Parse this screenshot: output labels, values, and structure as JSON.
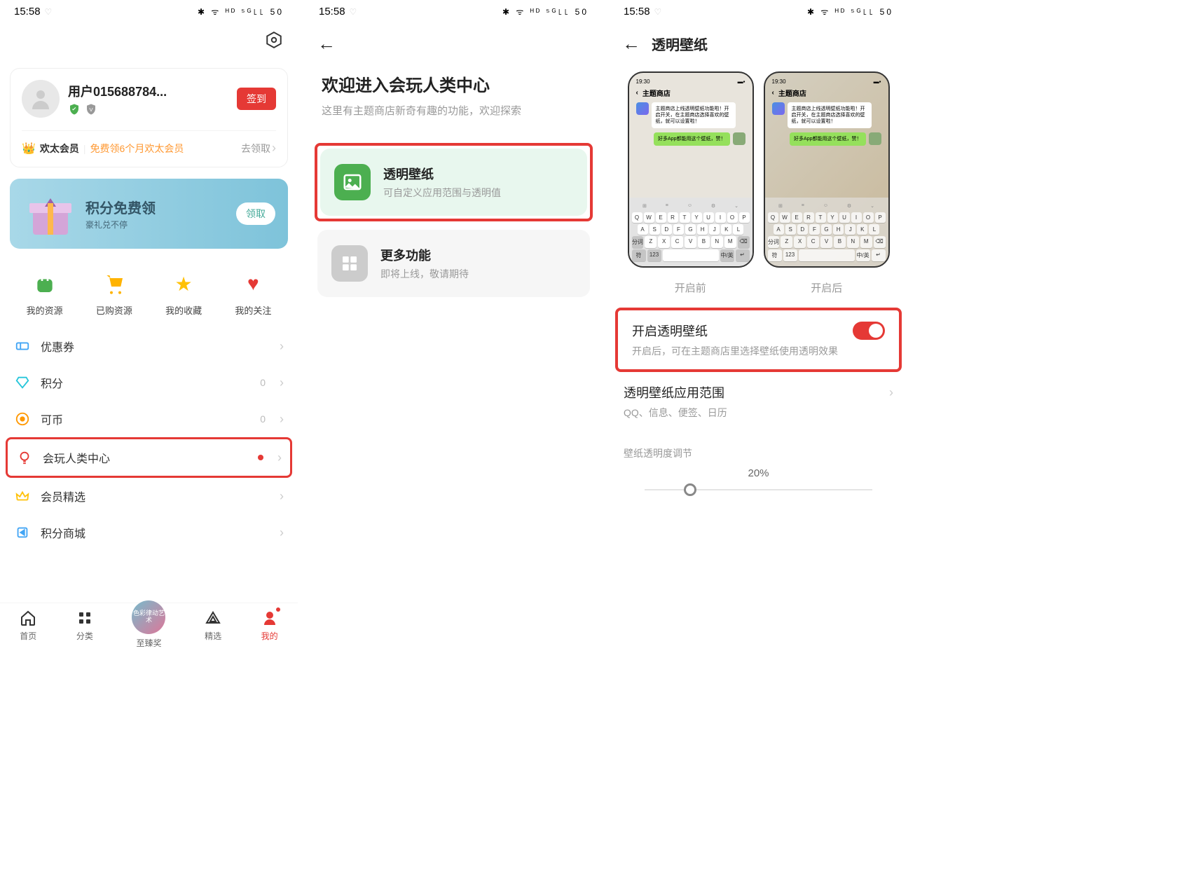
{
  "status": {
    "time": "15:58",
    "icons": "✱ ᯤ ᴴᴰ ⁵ᴳ꜖꜖ 50"
  },
  "phone1": {
    "username": "用户015688784...",
    "signin": "签到",
    "member_label": "欢太会员",
    "member_promo": "免费领6个月欢太会员",
    "member_action": "去领取",
    "points_title": "积分免费领",
    "points_sub": "豪礼兑不停",
    "claim": "领取",
    "quick": [
      "我的资源",
      "已购资源",
      "我的收藏",
      "我的关注"
    ],
    "menu": {
      "coupon": "优惠券",
      "points": "积分",
      "points_val": "0",
      "coin": "可币",
      "coin_val": "0",
      "play": "会玩人类中心",
      "premium": "会员精选",
      "mall": "积分商城"
    },
    "nav": [
      "首页",
      "分类",
      "至臻奖",
      "精选",
      "我的"
    ],
    "nav_center": "色彩律动艺术"
  },
  "phone2": {
    "title": "欢迎进入会玩人类中心",
    "subtitle": "这里有主题商店新奇有趣的功能，欢迎探索",
    "card1_title": "透明壁纸",
    "card1_sub": "可自定义应用范围与透明值",
    "card2_title": "更多功能",
    "card2_sub": "即将上线，敬请期待"
  },
  "phone3": {
    "header": "透明壁纸",
    "preview_statusbar_time": "19:30",
    "preview_header": "主题商店",
    "chat_msg1": "主题商店上线透明壁纸功能啦！开启开关，在主题商店选择喜欢的壁纸，就可以设置啦！",
    "chat_msg2": "好多App都能用这个壁纸，赞！",
    "kb_rows": {
      "r1": [
        "Q",
        "W",
        "E",
        "R",
        "T",
        "Y",
        "U",
        "I",
        "O",
        "P"
      ],
      "r2": [
        "A",
        "S",
        "D",
        "F",
        "G",
        "H",
        "J",
        "K",
        "L"
      ],
      "r3_left": "分词",
      "r3": [
        "Z",
        "X",
        "C",
        "V",
        "B",
        "N",
        "M"
      ],
      "r3_right": "⌫",
      "r4": {
        "sym": "符",
        "num": "123",
        "space": "",
        "cn": "中/英",
        "enter": "↵"
      }
    },
    "label_before": "开启前",
    "label_after": "开启后",
    "enable_title": "开启透明壁纸",
    "enable_sub": "开启后，可在主题商店里选择壁纸使用透明效果",
    "scope_title": "透明壁纸应用范围",
    "scope_sub": "QQ、信息、便签、日历",
    "opacity_label": "壁纸透明度调节",
    "opacity_value": "20%"
  }
}
